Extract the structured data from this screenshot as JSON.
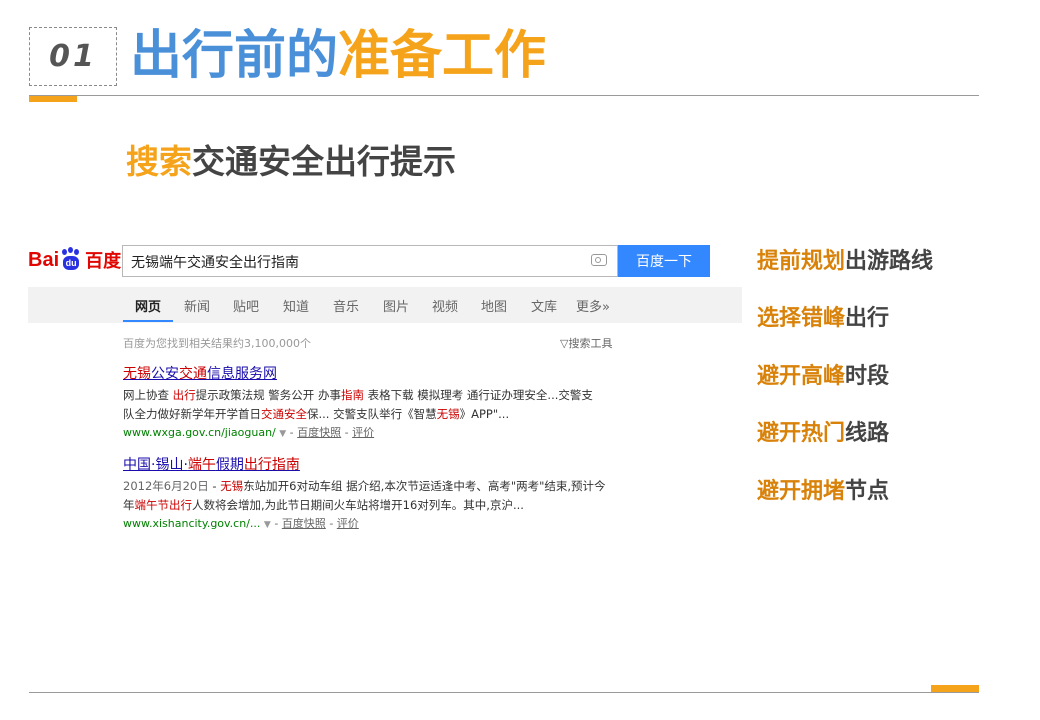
{
  "header": {
    "number": "01",
    "title_part1": "出行前的",
    "title_part2": "准备工作"
  },
  "subtitle": {
    "highlight": "搜索",
    "rest": "交通安全出行提示"
  },
  "baidu": {
    "logo_text": "Bai",
    "logo_du": "du",
    "logo_cn": "百度",
    "query": "无锡端午交通安全出行指南",
    "search_button": "百度一下",
    "tabs": [
      "网页",
      "新闻",
      "贴吧",
      "知道",
      "音乐",
      "图片",
      "视频",
      "地图",
      "文库",
      "更多»"
    ],
    "result_count": "百度为您找到相关结果约3,100,000个",
    "search_tools": "搜索工具",
    "results": [
      {
        "title_pre": "",
        "title_em": "无锡",
        "title_mid": "公安",
        "title_em2": "交通",
        "title_post": "信息服务网",
        "desc1_a": "网上协查 ",
        "desc1_em": "出行",
        "desc1_b": "提示政策法规 警务公开 办事",
        "desc1_em2": "指南",
        "desc1_c": " 表格下载 模拟理考 通行证办理安全...交警支",
        "desc2_a": "队全力做好新学年开学首日",
        "desc2_em": "交通安全",
        "desc2_b": "保... 交警支队举行《智慧",
        "desc2_em2": "无锡",
        "desc2_c": "》APP\"...",
        "url": "www.wxga.gov.cn/jiaoguan/",
        "snapshot": "百度快照",
        "rating": "评价"
      },
      {
        "title_pre": "中国·锡山·",
        "title_em": "端午",
        "title_mid": "假期",
        "title_em2": "出行指南",
        "title_post": "",
        "date": "2012年6月20日",
        "desc1_a": " - ",
        "desc1_em": "无锡",
        "desc1_b": "东站加开6对动车组 据介绍,本次节运适逢中考、高考\"两考\"结束,预计今",
        "desc2_a": "年",
        "desc2_em": "端午节出行",
        "desc2_b": "人数将会增加,为此节日期间火车站将增开16对列车。其中,京沪...",
        "url": "www.xishancity.gov.cn/...",
        "snapshot": "百度快照",
        "rating": "评价"
      }
    ]
  },
  "tips": [
    {
      "highlight": "提前规划",
      "rest": "出游路线"
    },
    {
      "highlight": "选择错峰",
      "rest": "出行"
    },
    {
      "highlight": "避开高峰",
      "rest": "时段"
    },
    {
      "highlight": "避开热门",
      "rest": "线路"
    },
    {
      "highlight": "避开拥堵",
      "rest": "节点"
    }
  ],
  "colors": {
    "accent_orange": "#f5a31a",
    "title_blue": "#4a90d9",
    "baidu_blue": "#3388ff",
    "baidu_red": "#e10601"
  }
}
